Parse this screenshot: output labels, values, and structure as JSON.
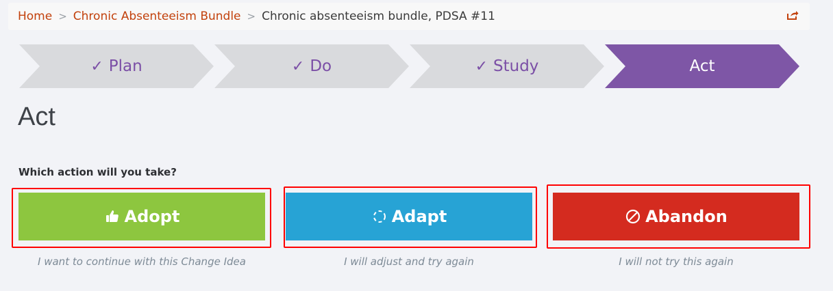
{
  "breadcrumb": {
    "home": "Home",
    "bundle": "Chronic Absenteeism Bundle",
    "current": "Chronic absenteeism bundle, PDSA #11",
    "separator": ">"
  },
  "steps": [
    {
      "label": "Plan",
      "check": "✓",
      "state": "done"
    },
    {
      "label": "Do",
      "check": "✓",
      "state": "done"
    },
    {
      "label": "Study",
      "check": "✓",
      "state": "done"
    },
    {
      "label": "Act",
      "state": "active"
    }
  ],
  "heading": "Act",
  "question": "Which action will you take?",
  "actions": {
    "adopt": {
      "label": "Adopt",
      "icon": "thumbs-up-icon",
      "caption": "I want to continue with this Change Idea",
      "color": "#8dc63f"
    },
    "adapt": {
      "label": "Adapt",
      "icon": "refresh-icon",
      "caption": "I will adjust and try again",
      "color": "#27a3d5"
    },
    "abandon": {
      "label": "Abandon",
      "icon": "ban-icon",
      "caption": "I will not try this again",
      "color": "#d42b1f"
    }
  },
  "colors": {
    "accent": "#c2410c",
    "active_step": "#7e56a6",
    "done_step": "#d9dadd"
  }
}
